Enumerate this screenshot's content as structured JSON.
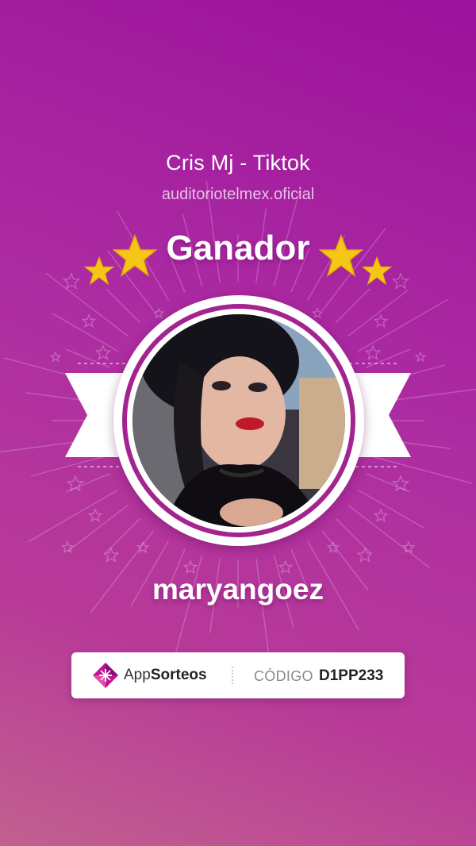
{
  "giveaway": {
    "title": "Cris Mj - Tiktok",
    "account": "auditoriotelmex.oficial",
    "heading": "Ganador",
    "winner_username": "maryangoez"
  },
  "footer": {
    "brand_prefix": "App",
    "brand_suffix": "Sorteos",
    "code_label": "CÓDIGO",
    "code_value": "D1PP233"
  },
  "colors": {
    "background_top": "#9c129c",
    "background_bottom": "#c2608f",
    "star": "#f5c518",
    "ring": "#a4248f"
  },
  "icons": [
    "star-icon",
    "appsorteos-logo-icon",
    "avatar-photo"
  ]
}
